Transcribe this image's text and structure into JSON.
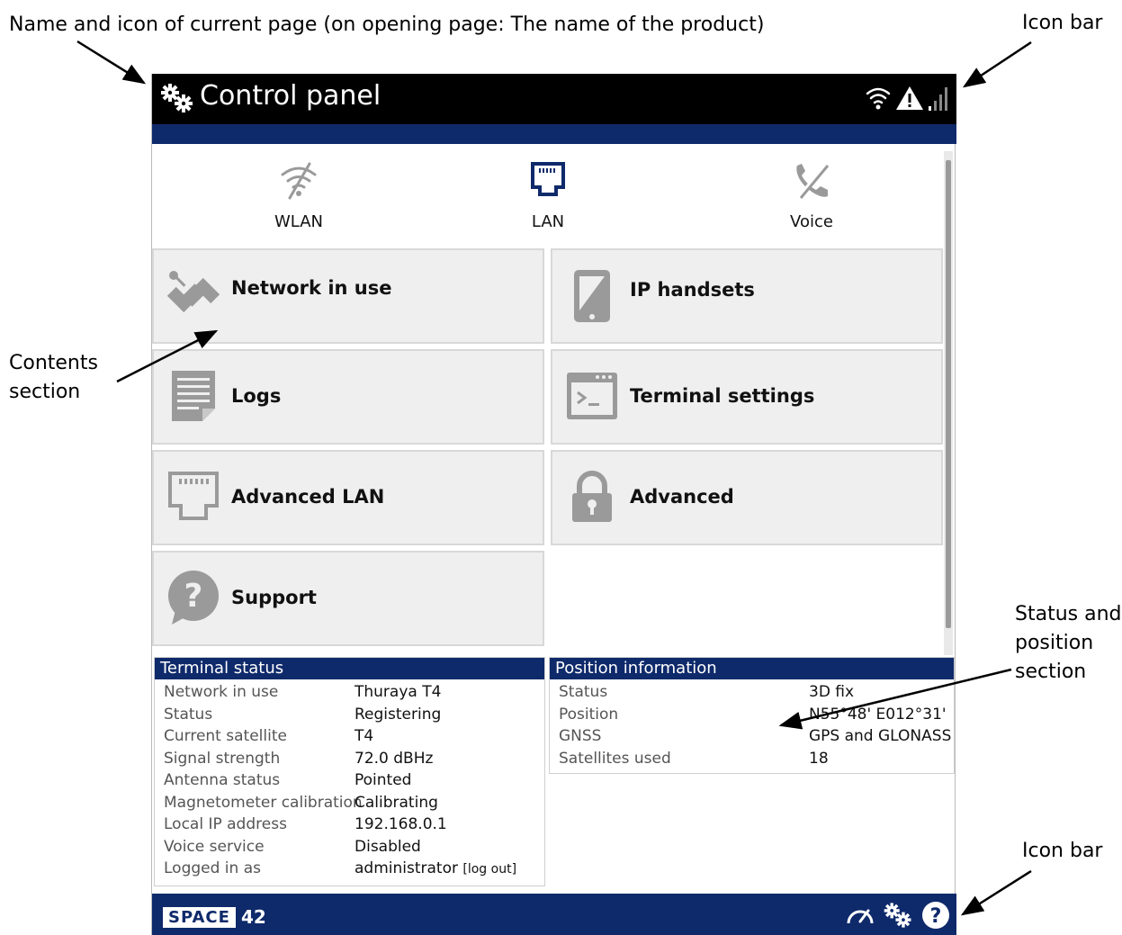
{
  "annotations": {
    "top_left": "Name and icon of current page (on opening page: The name of the product)",
    "top_right": "Icon bar",
    "contents_line1": "Contents",
    "contents_line2": "section",
    "status_line1": "Status and",
    "status_line2": "position",
    "status_line3": "section",
    "bottom_right": "Icon bar"
  },
  "header": {
    "title": "Control panel",
    "title_icon": "gears-icon"
  },
  "status_icons": [
    "wifi-icon",
    "warning-icon",
    "signal-bars-icon"
  ],
  "nav": [
    {
      "label": "WLAN",
      "icon": "wlan-disabled-icon"
    },
    {
      "label": "LAN",
      "icon": "lan-port-icon"
    },
    {
      "label": "Voice",
      "icon": "phone-disabled-icon"
    }
  ],
  "tiles": [
    {
      "label": "Network in use",
      "icon": "satellite-icon"
    },
    {
      "label": "IP handsets",
      "icon": "handset-icon"
    },
    {
      "label": "Logs",
      "icon": "logs-icon"
    },
    {
      "label": "Terminal settings",
      "icon": "terminal-icon"
    },
    {
      "label": "Advanced LAN",
      "icon": "lan-port-icon"
    },
    {
      "label": "Advanced",
      "icon": "lock-icon"
    },
    {
      "label": "Support",
      "icon": "question-bubble-icon"
    }
  ],
  "terminal_status": {
    "title": "Terminal status",
    "rows": [
      {
        "key": "Network in use",
        "value": "Thuraya T4"
      },
      {
        "key": "Status",
        "value": "Registering"
      },
      {
        "key": "Current satellite",
        "value": "T4"
      },
      {
        "key": "Signal strength",
        "value": "72.0 dBHz"
      },
      {
        "key": "Antenna status",
        "value": "Pointed"
      },
      {
        "key": "Magnetometer calibration",
        "value": "Calibrating"
      },
      {
        "key": "Local IP address",
        "value": "192.168.0.1"
      },
      {
        "key": "Voice service",
        "value": "Disabled"
      },
      {
        "key": "Logged in as",
        "value": "administrator"
      }
    ],
    "logout_label": "[log out]"
  },
  "position_info": {
    "title": "Position information",
    "rows": [
      {
        "key": "Status",
        "value": "3D fix"
      },
      {
        "key": "Position",
        "value": "N55°48' E012°31'"
      },
      {
        "key": "GNSS",
        "value": "GPS and GLONASS"
      },
      {
        "key": "Satellites used",
        "value": "18"
      }
    ]
  },
  "footer": {
    "logo_text": "SPACE",
    "logo_number": "42",
    "icons": [
      "speedometer-icon",
      "gears-icon",
      "help-icon"
    ]
  },
  "colors": {
    "title_bar": "#000000",
    "accent_blue": "#0f2a6b",
    "tile_bg": "#efefef"
  }
}
